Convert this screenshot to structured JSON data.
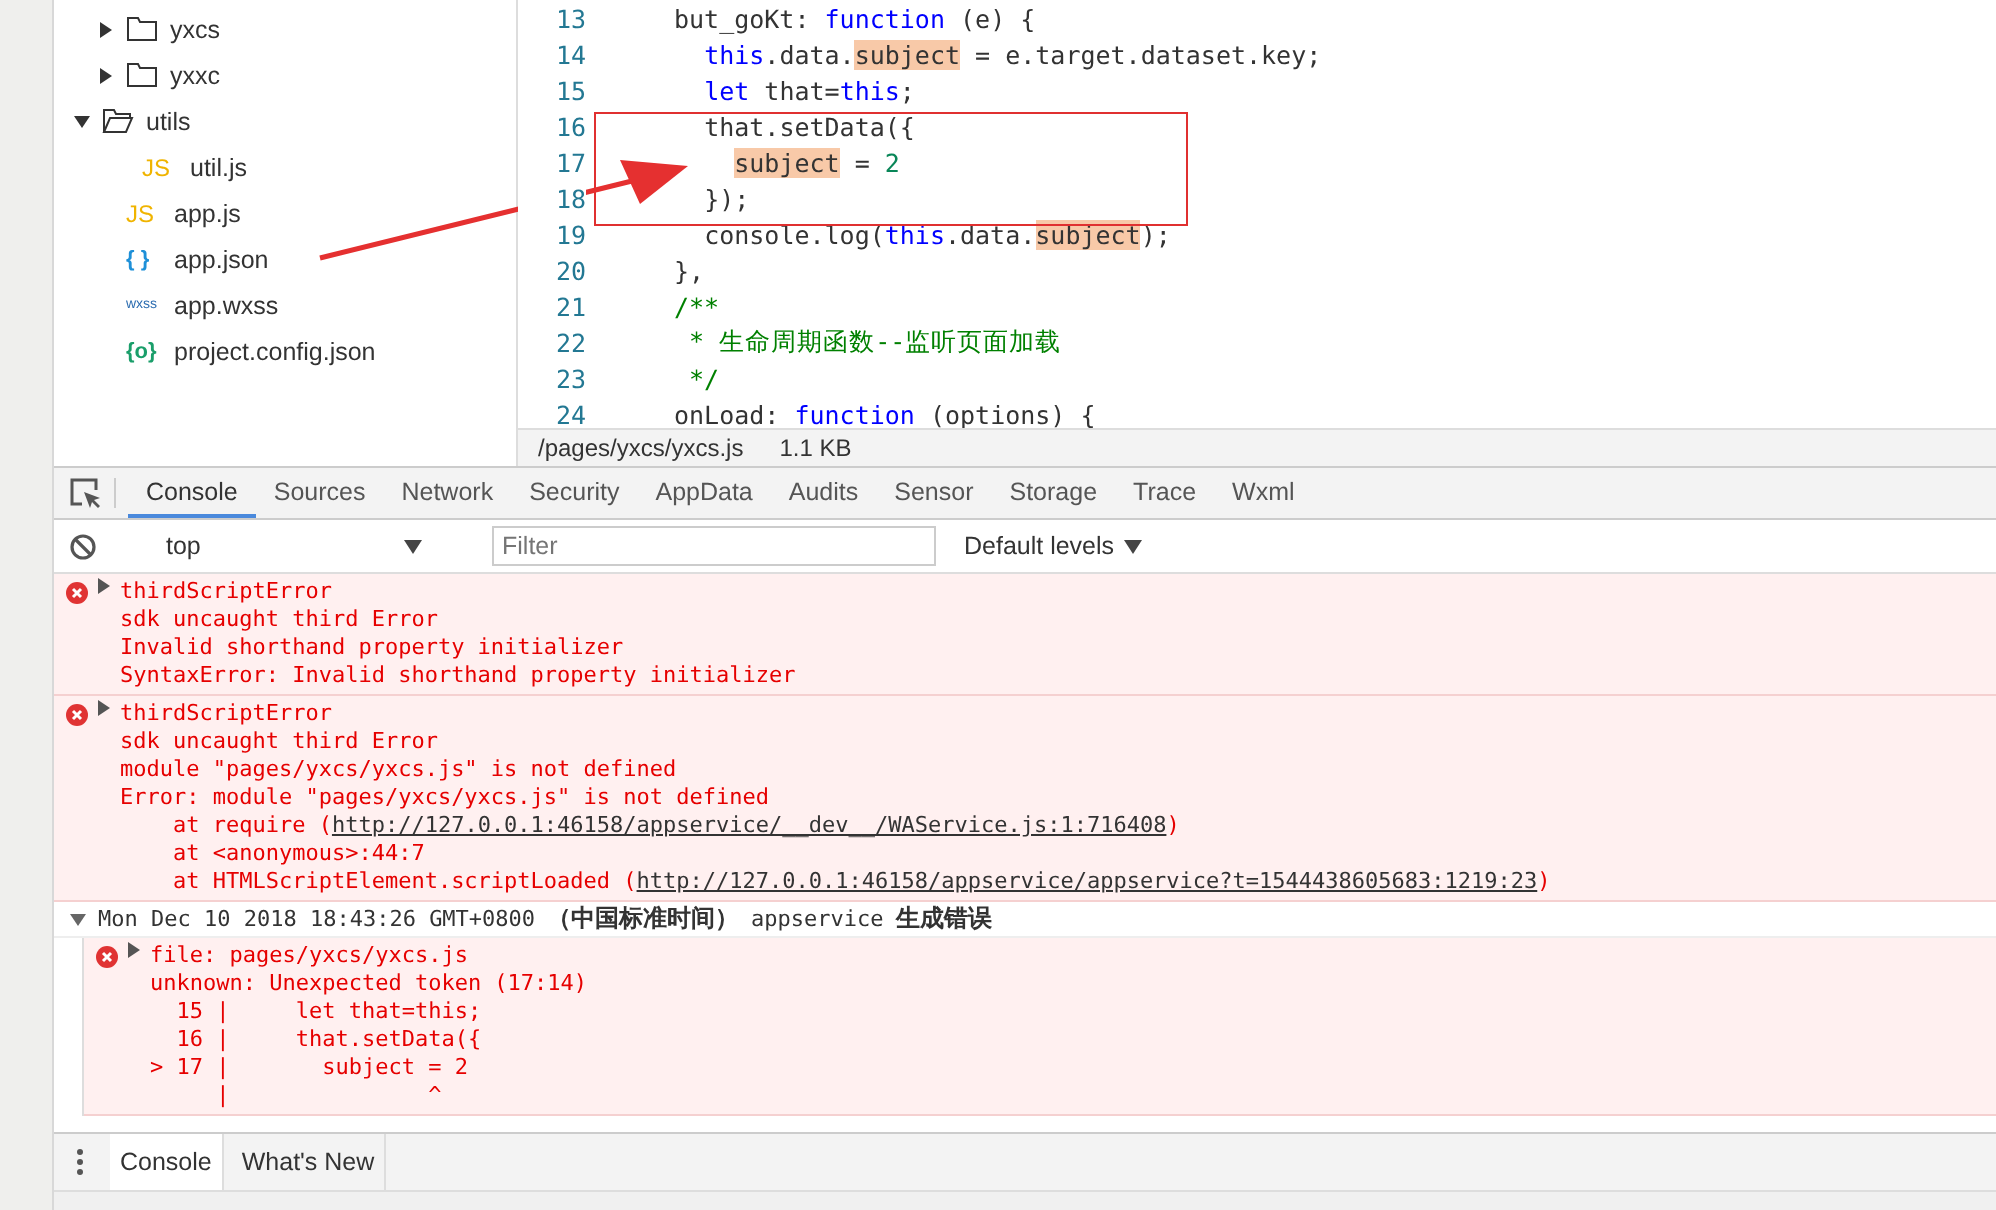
{
  "file_tree": {
    "scrolled_folder_children": [
      {
        "kind": "folder",
        "label": "yxcs",
        "expanded": false
      },
      {
        "kind": "folder",
        "label": "yxxc",
        "expanded": false
      }
    ],
    "items": [
      {
        "kind": "folder",
        "label": "utils",
        "expanded": true,
        "children": [
          {
            "kind": "js",
            "badge": "JS",
            "label": "util.js"
          }
        ]
      },
      {
        "kind": "js",
        "badge": "JS",
        "label": "app.js"
      },
      {
        "kind": "json",
        "badge": "{ }",
        "label": "app.json"
      },
      {
        "kind": "wxss",
        "badge": "wxss",
        "label": "app.wxss"
      },
      {
        "kind": "config",
        "badge": "{o}",
        "label": "project.config.json"
      }
    ]
  },
  "editor": {
    "lines": [
      {
        "number": "13",
        "tokens": [
          {
            "kind": "plain",
            "text": "but_goKt: "
          },
          {
            "kind": "keyword",
            "text": "function"
          },
          {
            "kind": "plain",
            "text": " (e) {"
          }
        ]
      },
      {
        "number": "14",
        "tokens": [
          {
            "kind": "keyword",
            "text": "  this"
          },
          {
            "kind": "plain",
            "text": ".data."
          },
          {
            "kind": "match",
            "text": "subject"
          },
          {
            "kind": "plain",
            "text": " = e.target.dataset.key;"
          }
        ]
      },
      {
        "number": "15",
        "tokens": [
          {
            "kind": "keyword",
            "text": "  let"
          },
          {
            "kind": "plain",
            "text": " that="
          },
          {
            "kind": "keyword",
            "text": "this"
          },
          {
            "kind": "plain",
            "text": ";"
          }
        ]
      },
      {
        "number": "16",
        "tokens": [
          {
            "kind": "plain",
            "text": "  that.setData({"
          }
        ]
      },
      {
        "number": "17",
        "tokens": [
          {
            "kind": "match",
            "text": "    subject"
          },
          {
            "kind": "plain",
            "text": " = "
          },
          {
            "kind": "number",
            "text": "2"
          }
        ]
      },
      {
        "number": "18",
        "tokens": [
          {
            "kind": "plain",
            "text": "  });"
          }
        ]
      },
      {
        "number": "19",
        "tokens": [
          {
            "kind": "plain",
            "text": "  console.log("
          },
          {
            "kind": "keyword",
            "text": "this"
          },
          {
            "kind": "plain",
            "text": ".data."
          },
          {
            "kind": "match",
            "text": "subject"
          },
          {
            "kind": "plain",
            "text": ");"
          }
        ]
      },
      {
        "number": "20",
        "tokens": [
          {
            "kind": "plain",
            "text": "},"
          }
        ]
      },
      {
        "number": "21",
        "tokens": [
          {
            "kind": "comment",
            "text": "/**"
          }
        ]
      },
      {
        "number": "22",
        "tokens": [
          {
            "kind": "comment",
            "text": " * 生命周期函数--监听页面加载"
          }
        ]
      },
      {
        "number": "23",
        "tokens": [
          {
            "kind": "comment",
            "text": " */"
          }
        ]
      },
      {
        "number": "24",
        "tokens": [
          {
            "kind": "plain",
            "text": "onLoad: "
          },
          {
            "kind": "keyword",
            "text": "function"
          },
          {
            "kind": "plain",
            "text": " (options) {"
          }
        ]
      }
    ],
    "status": {
      "path": "/pages/yxcs/yxcs.js",
      "size": "1.1 KB"
    }
  },
  "devtools_tabs": [
    {
      "label": "Console",
      "selected": true
    },
    {
      "label": "Sources",
      "selected": false
    },
    {
      "label": "Network",
      "selected": false
    },
    {
      "label": "Security",
      "selected": false
    },
    {
      "label": "AppData",
      "selected": false
    },
    {
      "label": "Audits",
      "selected": false
    },
    {
      "label": "Sensor",
      "selected": false
    },
    {
      "label": "Storage",
      "selected": false
    },
    {
      "label": "Trace",
      "selected": false
    },
    {
      "label": "Wxml",
      "selected": false
    }
  ],
  "console_toolbar": {
    "context": "top",
    "filter_placeholder": "Filter",
    "levels": "Default levels"
  },
  "messages": [
    {
      "title": "thirdScriptError",
      "lines": [
        [
          {
            "text": "sdk uncaught third Error"
          }
        ],
        [
          {
            "text": "Invalid shorthand property initializer"
          }
        ],
        [
          {
            "text": "SyntaxError: Invalid shorthand property initializer"
          }
        ]
      ]
    },
    {
      "title": "thirdScriptError",
      "lines": [
        [
          {
            "text": "sdk uncaught third Error"
          }
        ],
        [
          {
            "text": "module \"pages/yxcs/yxcs.js\" is not defined"
          }
        ],
        [
          {
            "text": "Error: module \"pages/yxcs/yxcs.js\" is not defined"
          }
        ],
        [
          {
            "text": "    at require ("
          },
          {
            "text": "http://127.0.0.1:46158/appservice/__dev__/WAService.js:1:716408",
            "link": true
          },
          {
            "text": ")"
          }
        ],
        [
          {
            "text": "    at <anonymous>:44:7"
          }
        ],
        [
          {
            "text": "    at HTMLScriptElement.scriptLoaded ("
          },
          {
            "text": "http://127.0.0.1:46158/appservice/appservice?t=1544438605683:1219:23",
            "link": true
          },
          {
            "text": ")"
          }
        ]
      ]
    }
  ],
  "group": {
    "expanded": true,
    "timestamp": "Mon Dec 10 2018 18:43:26 GMT+0800",
    "zone": "（中国标准时间）",
    "source": "appservice",
    "label": "生成错误",
    "messages": [
      {
        "title": "file: pages/yxcs/yxcs.js",
        "lines": [
          [
            {
              "text": "unknown: Unexpected token (17:14)"
            }
          ],
          [
            {
              "text": "  15 |     let that=this;"
            }
          ],
          [
            {
              "text": "  16 |     that.setData({"
            }
          ],
          [
            {
              "text": "> 17 |       subject = 2"
            }
          ],
          [
            {
              "text": "     |               ^"
            }
          ]
        ]
      }
    ]
  },
  "drawer_tabs": [
    {
      "label": "Console",
      "selected": true
    },
    {
      "label": "What's New",
      "selected": false
    }
  ]
}
